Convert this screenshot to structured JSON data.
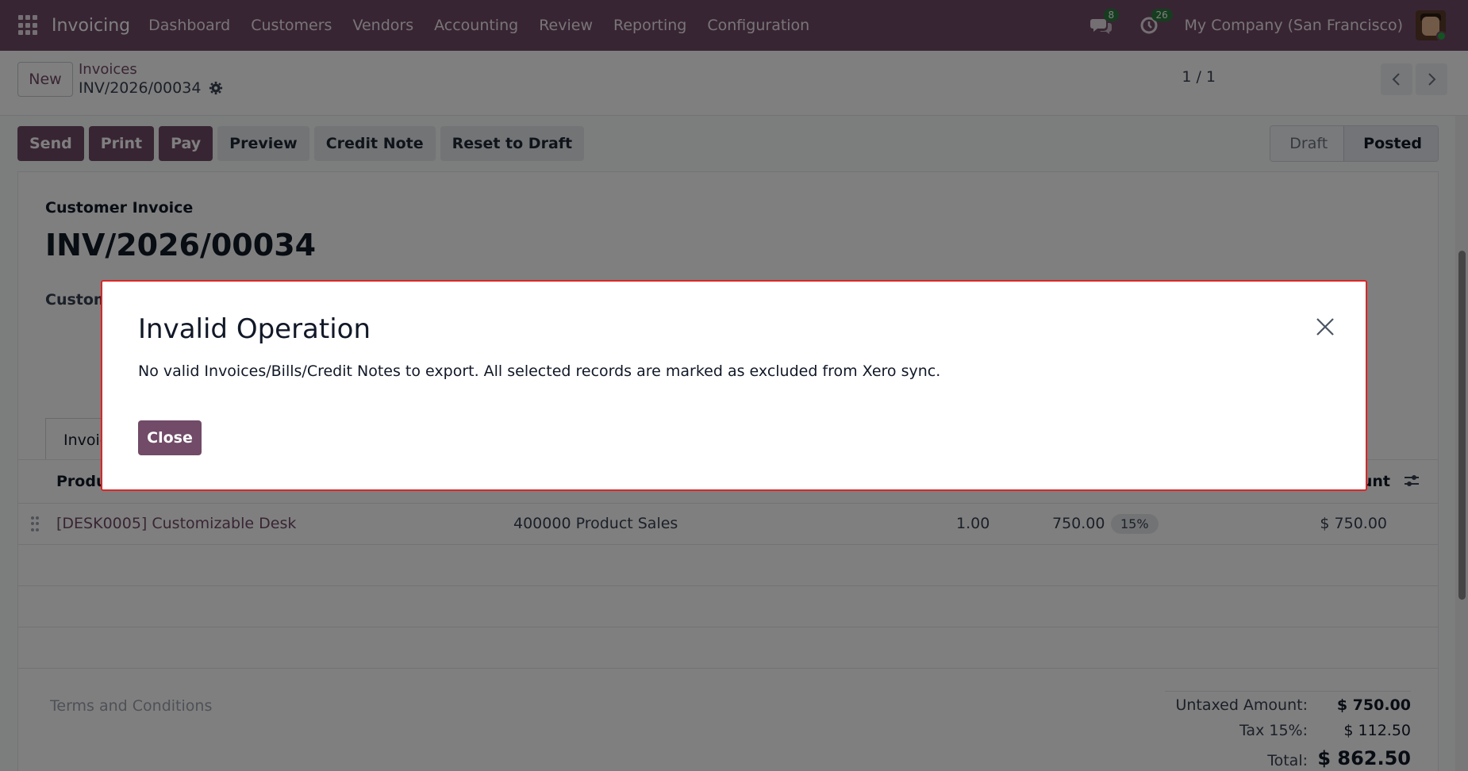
{
  "nav": {
    "app_title": "Invoicing",
    "menu": [
      "Dashboard",
      "Customers",
      "Vendors",
      "Accounting",
      "Review",
      "Reporting",
      "Configuration"
    ],
    "messages_count": "8",
    "activities_count": "26",
    "company": "My Company (San Francisco)",
    "brand_color": "#714b67"
  },
  "control": {
    "new_label": "New",
    "breadcrumb_parent": "Invoices",
    "breadcrumb_current": "INV/2026/00034",
    "pager": "1 / 1"
  },
  "actions": {
    "send": "Send",
    "print": "Print",
    "pay": "Pay",
    "preview": "Preview",
    "credit_note": "Credit Note",
    "reset_to_draft": "Reset to Draft"
  },
  "status": {
    "draft": "Draft",
    "posted": "Posted",
    "current": "Posted"
  },
  "sheet": {
    "type_label": "Customer Invoice",
    "number": "INV/2026/00034",
    "customer_label": "Custom",
    "tab_label": "Invoic",
    "col_product": "Produ",
    "col_amount": "unt",
    "line": {
      "product": "[DESK0005] Customizable Desk",
      "account": "400000 Product Sales",
      "quantity": "1.00",
      "price": "750.00",
      "tax": "15%",
      "amount": "$ 750.00"
    },
    "terms": "Terms and Conditions",
    "totals": {
      "untaxed_label": "Untaxed Amount:",
      "untaxed_value": "$ 750.00",
      "tax_label": "Tax 15%:",
      "tax_value": "$ 112.50",
      "total_label": "Total:",
      "total_value": "$ 862.50"
    }
  },
  "modal": {
    "title": "Invalid Operation",
    "message": "No valid Invoices/Bills/Credit Notes to export. All selected records are marked as excluded from Xero sync.",
    "close_label": "Close"
  }
}
